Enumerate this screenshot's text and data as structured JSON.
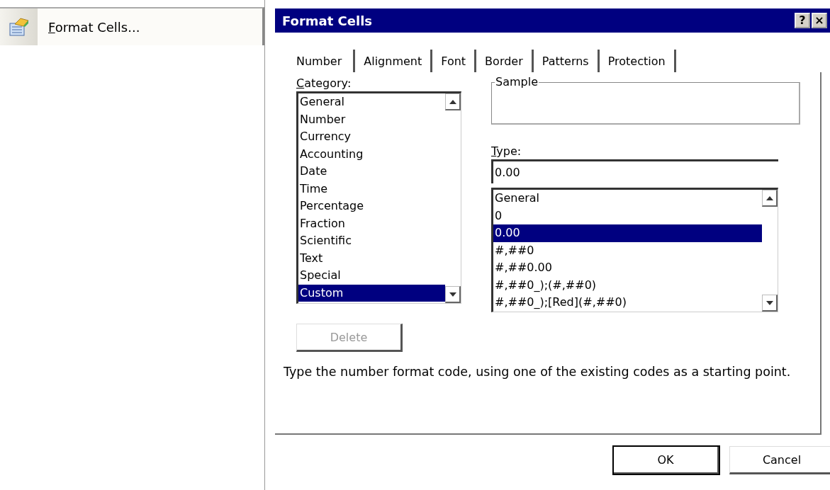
{
  "menu_item": {
    "label": "Format Cells...",
    "underline_first": true
  },
  "dialog": {
    "title": "Format Cells",
    "help_button": "?",
    "close_button": "×",
    "tabs": [
      {
        "label": "Number",
        "selected": true
      },
      {
        "label": "Alignment",
        "selected": false
      },
      {
        "label": "Font",
        "selected": false
      },
      {
        "label": "Border",
        "selected": false
      },
      {
        "label": "Patterns",
        "selected": false
      },
      {
        "label": "Protection",
        "selected": false
      }
    ],
    "category": {
      "label": "Category:",
      "underline_first": true,
      "items": [
        {
          "label": "General",
          "selected": false
        },
        {
          "label": "Number",
          "selected": false
        },
        {
          "label": "Currency",
          "selected": false
        },
        {
          "label": "Accounting",
          "selected": false
        },
        {
          "label": "Date",
          "selected": false
        },
        {
          "label": "Time",
          "selected": false
        },
        {
          "label": "Percentage",
          "selected": false
        },
        {
          "label": "Fraction",
          "selected": false
        },
        {
          "label": "Scientific",
          "selected": false
        },
        {
          "label": "Text",
          "selected": false
        },
        {
          "label": "Special",
          "selected": false
        },
        {
          "label": "Custom",
          "selected": true
        }
      ]
    },
    "sample": {
      "label": "Sample"
    },
    "type": {
      "label": "Type:",
      "underline_first": true,
      "value": "0.00",
      "items": [
        {
          "label": "General",
          "selected": false
        },
        {
          "label": "0",
          "selected": false
        },
        {
          "label": "0.00",
          "selected": true
        },
        {
          "label": "#,##0",
          "selected": false
        },
        {
          "label": "#,##0.00",
          "selected": false
        },
        {
          "label": "#,##0_);(#,##0)",
          "selected": false
        },
        {
          "label": "#,##0_);[Red](#,##0)",
          "selected": false
        }
      ]
    },
    "delete_button": {
      "label": "Delete",
      "disabled": true
    },
    "description": "Type the number format code, using one of the existing codes as a starting point.",
    "buttons": [
      {
        "label": "OK",
        "default": true
      },
      {
        "label": "Cancel",
        "default": false
      }
    ]
  }
}
